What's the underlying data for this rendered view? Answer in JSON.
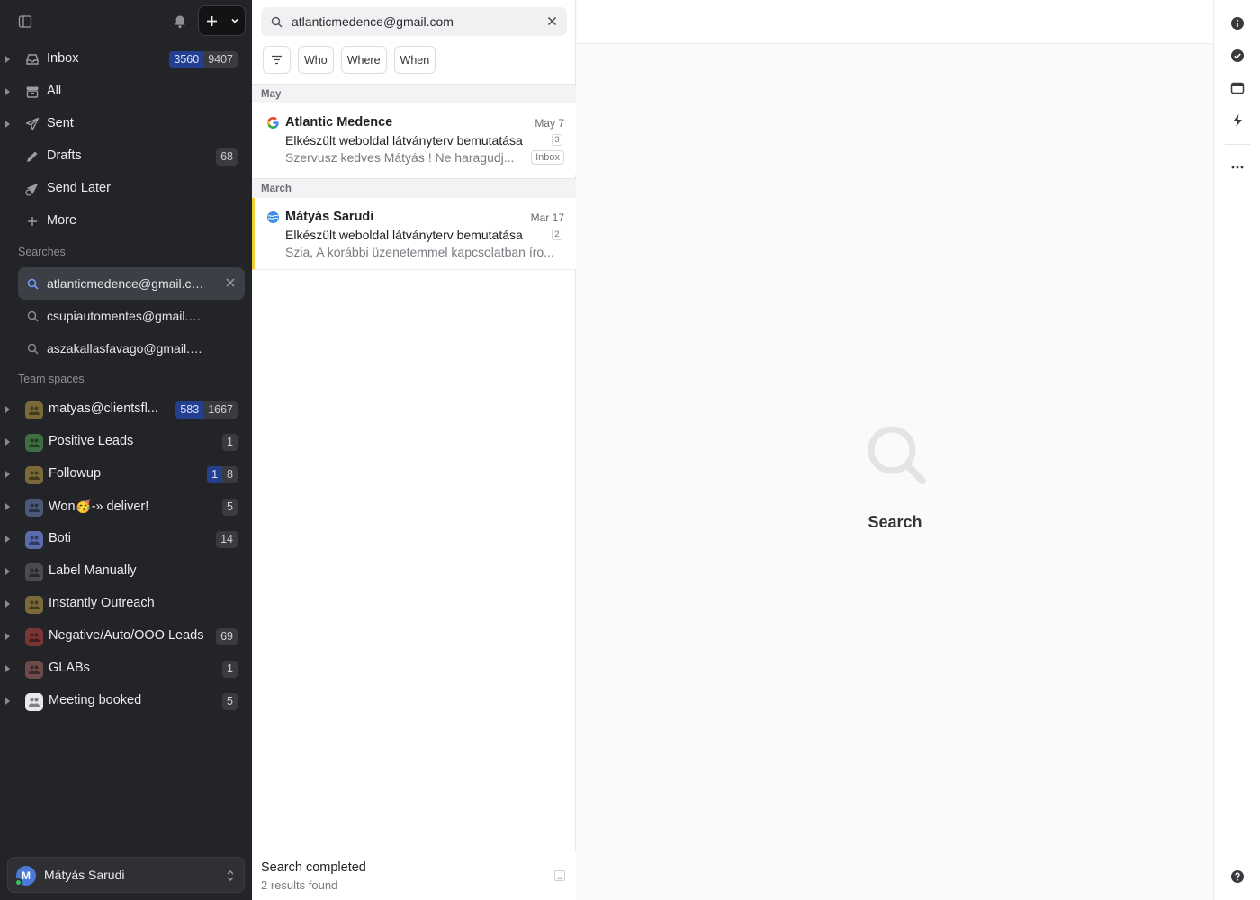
{
  "sidebar": {
    "mailboxes": [
      {
        "label": "Inbox",
        "unread": "3560",
        "total": "9407",
        "icon": "inbox-icon"
      },
      {
        "label": "All",
        "icon": "archive-icon"
      },
      {
        "label": "Sent",
        "icon": "send-icon"
      },
      {
        "label": "Drafts",
        "total": "68",
        "icon": "pencil-icon"
      },
      {
        "label": "Send Later",
        "icon": "send-later-icon"
      },
      {
        "label": "More",
        "icon": "plus-icon"
      }
    ],
    "searches_title": "Searches",
    "searches": [
      {
        "label": "atlanticmedence@gmail.com"
      },
      {
        "label": "csupiautomentes@gmail.com"
      },
      {
        "label": "aszakallasfavago@gmail.com"
      }
    ],
    "team_title": "Team spaces",
    "teams": [
      {
        "label": "matyas@clientsfl...",
        "unread": "583",
        "total": "1667",
        "color": "#7a6a3a"
      },
      {
        "label": "Positive Leads",
        "total": "1",
        "color": "#3f6e43"
      },
      {
        "label": "Followup",
        "unread": "1",
        "total": "8",
        "color": "#7a6a3a"
      },
      {
        "label": "Won🥳-» deliver!",
        "total": "5",
        "color": "#4c5878"
      },
      {
        "label": "Boti",
        "total": "14",
        "color": "#5b6cae"
      },
      {
        "label": "Label Manually",
        "color": "#4b4c50"
      },
      {
        "label": "Instantly Outreach",
        "color": "#7a6a3a"
      },
      {
        "label": "Negative/Auto/OOO Leads",
        "total": "69",
        "color": "#7a3535"
      },
      {
        "label": "GLABs",
        "total": "1",
        "color": "#6e4a4a"
      },
      {
        "label": "Meeting booked",
        "total": "5",
        "color": "#e9e9ec"
      }
    ],
    "account": {
      "initial": "M",
      "name": "Mátyás Sarudi"
    }
  },
  "list": {
    "search_value": "atlanticmedence@gmail.com",
    "filters": [
      "Who",
      "Where",
      "When"
    ],
    "groups": [
      {
        "title": "May",
        "messages": [
          {
            "from": "Atlantic Medence",
            "date": "May 7",
            "subject": "Elkészült weboldal látványterv bemutatása",
            "count": "3",
            "preview": "Szervusz kedves Mátyás ! Ne haragudj...",
            "tag": "Inbox",
            "source": "google-icon"
          }
        ]
      },
      {
        "title": "March",
        "messages": [
          {
            "from": "Mátyás Sarudi",
            "date": "Mar 17",
            "subject": "Elkészült weboldal látványterv bemutatása",
            "count": "2",
            "preview": "Szia, A korábbi üzenetemmel kapcsolatban íro...",
            "source": "globe-icon"
          }
        ]
      }
    ],
    "status_title": "Search completed",
    "status_sub": "2 results found"
  },
  "detail": {
    "empty_label": "Search"
  },
  "colors": {
    "sidebar_bg": "#232427",
    "unread_badge": "#243f8f",
    "marked_bar": "#f2cf36"
  }
}
